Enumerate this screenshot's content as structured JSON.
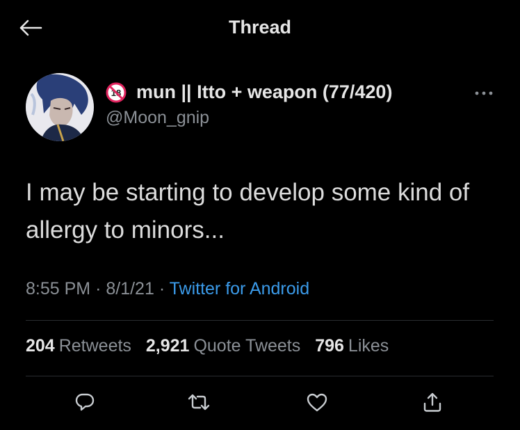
{
  "header": {
    "title": "Thread",
    "back_icon": "arrow-left-icon"
  },
  "tweet": {
    "badge_text": "18",
    "display_name": "mun || Itto + weapon (77/420)",
    "handle": "@Moon_gnip",
    "more_icon": "ellipsis-icon",
    "text": "I may be starting to develop some kind of allergy to minors...",
    "time": "8:55 PM",
    "date": "8/1/21",
    "separator": "·",
    "source": "Twitter for Android"
  },
  "stats": {
    "retweets_count": "204",
    "retweets_label": "Retweets",
    "quotes_count": "2,921",
    "quotes_label": "Quote Tweets",
    "likes_count": "796",
    "likes_label": "Likes"
  },
  "actions": [
    "reply-icon",
    "retweet-icon",
    "like-icon",
    "share-icon"
  ],
  "colors": {
    "background": "#000000",
    "link": "#3b9bea",
    "secondary_text": "#8b9096",
    "primary_text": "#e6e6e6",
    "badge_red": "#e0245e"
  }
}
